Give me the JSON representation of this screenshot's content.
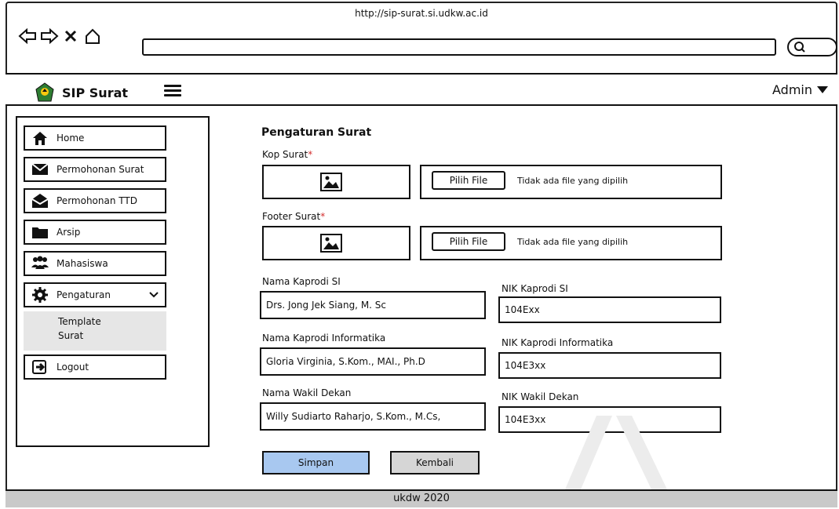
{
  "browser": {
    "url": "http://sip-surat.si.udkw.ac.id"
  },
  "header": {
    "app_title": "SIP Surat",
    "user_label": "Admin"
  },
  "sidebar": {
    "items": [
      {
        "label": "Home",
        "icon": "home-icon"
      },
      {
        "label": "Permohonan Surat",
        "icon": "envelope-icon"
      },
      {
        "label": "Permohonan TTD",
        "icon": "envelope-open-icon"
      },
      {
        "label": "Arsip",
        "icon": "folder-icon"
      },
      {
        "label": "Mahasiswa",
        "icon": "users-icon"
      },
      {
        "label": "Pengaturan",
        "icon": "gear-icon"
      }
    ],
    "submenu": {
      "line1": "Template",
      "line2": "Surat"
    },
    "logout": "Logout"
  },
  "main": {
    "title": "Pengaturan Surat",
    "kop_label": "Kop Surat",
    "footer_label": "Footer Surat",
    "required_mark": "*",
    "file_button": "Pilih File",
    "file_status": "Tidak ada file yang dipilih",
    "fields": {
      "nama_kaprodi_si_label": "Nama Kaprodi SI",
      "nama_kaprodi_si_value": "Drs. Jong Jek Siang, M. Sc",
      "nik_kaprodi_si_label": "NIK Kaprodi SI",
      "nik_kaprodi_si_value": "104Exx",
      "nama_kaprodi_inf_label": "Nama Kaprodi Informatika",
      "nama_kaprodi_inf_value": "Gloria Virginia, S.Kom., MAI., Ph.D",
      "nik_kaprodi_inf_label": "NIK Kaprodi Informatika",
      "nik_kaprodi_inf_value": "104E3xx",
      "nama_wakil_dekan_label": "Nama Wakil Dekan",
      "nama_wakil_dekan_value": "Willy Sudiarto Raharjo, S.Kom., M.Cs,",
      "nik_wakil_dekan_label": "NIK Wakil Dekan",
      "nik_wakil_dekan_value": "104E3xx"
    },
    "save_button": "Simpan",
    "back_button": "Kembali"
  },
  "footer": {
    "text": "ukdw 2020"
  },
  "colors": {
    "save_bg": "#a8c8f0",
    "back_bg": "#d6d6d6",
    "footer_bg": "#c9c9c9",
    "required": "#d32f2f"
  }
}
